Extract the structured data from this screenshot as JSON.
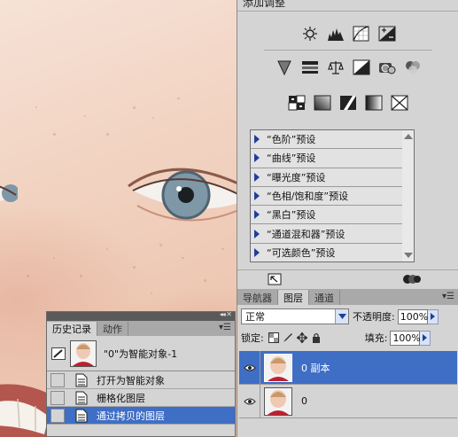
{
  "adjustments_panel": {
    "title": "添加调整",
    "icon_rows": [
      [
        "brightness-contrast-icon",
        "levels-icon",
        "curves-icon",
        "exposure-icon"
      ],
      [
        "vibrance-icon",
        "hue-saturation-icon",
        "color-balance-icon",
        "black-white-icon",
        "photo-filter-icon",
        "channel-mixer-icon"
      ],
      [
        "invert-icon",
        "posterize-icon",
        "threshold-icon",
        "gradient-map-icon",
        "selective-color-icon"
      ]
    ],
    "presets": [
      "“色阶”预设",
      "“曲线”预设",
      "“曝光度”预设",
      "“色相/饱和度”预设",
      "“黑白”预设",
      "“通道混和器”预设",
      "“可选颜色”预设"
    ]
  },
  "layers_panel": {
    "tabs": [
      "导航器",
      "图层",
      "通道"
    ],
    "active_tab": "图层",
    "menu_glyph": "▾☰",
    "blend_mode": "正常",
    "opacity_label": "不透明度:",
    "opacity_value": "100%",
    "lock_label": "锁定:",
    "fill_label": "填充:",
    "fill_value": "100%",
    "layers": [
      {
        "name": "0 副本",
        "selected": true
      },
      {
        "name": "0",
        "selected": false
      }
    ]
  },
  "history_panel": {
    "grip_glyph": "◂◂ ✕",
    "tabs": [
      "历史记录",
      "动作"
    ],
    "active_tab": "历史记录",
    "menu_glyph": "▾☰",
    "snapshot_label": "\"0\"为智能对象-1",
    "states": [
      {
        "label": "打开为智能对象",
        "selected": false
      },
      {
        "label": "栅格化图层",
        "selected": false
      },
      {
        "label": "通过拷贝的图层",
        "selected": true
      }
    ]
  },
  "colors": {
    "selection": "#3f6ec5",
    "panel_bg": "#d4d4d4",
    "tab_bar": "#a9a9a9"
  }
}
